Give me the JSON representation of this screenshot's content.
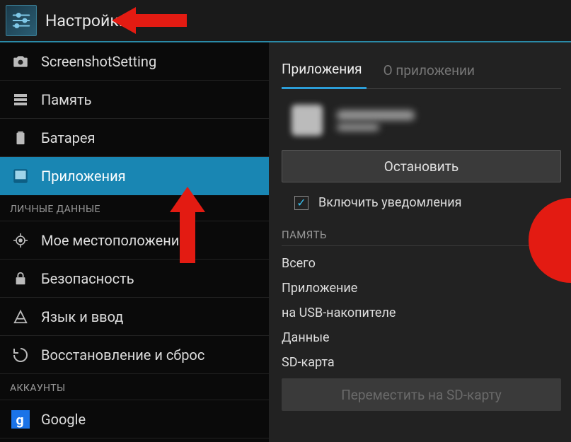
{
  "header": {
    "title": "Настройки"
  },
  "sidebar": {
    "items": [
      {
        "label": "ScreenshotSetting",
        "icon": "camera",
        "selected": false
      },
      {
        "label": "Память",
        "icon": "storage",
        "selected": false
      },
      {
        "label": "Батарея",
        "icon": "battery",
        "selected": false
      },
      {
        "label": "Приложения",
        "icon": "apps",
        "selected": true
      }
    ],
    "section_personal": "ЛИЧНЫЕ ДАННЫЕ",
    "items_personal": [
      {
        "label": "Мое местоположение",
        "icon": "location"
      },
      {
        "label": "Безопасность",
        "icon": "lock"
      },
      {
        "label": "Язык и ввод",
        "icon": "keyboard"
      },
      {
        "label": "Восстановление и сброс",
        "icon": "backup"
      }
    ],
    "section_accounts": "АККАУНТЫ",
    "items_accounts": [
      {
        "label": "Google",
        "icon": "google"
      }
    ]
  },
  "detail": {
    "tabs": {
      "apps": "Приложения",
      "about": "О приложении"
    },
    "btn_stop": "Остановить",
    "chk_notify": "Включить уведомления",
    "chk_notify_checked": true,
    "section_memory": "ПАМЯТЬ",
    "rows": {
      "total": "Всего",
      "app": "Приложение",
      "usb": "на USB-накопителе",
      "data": "Данные",
      "sd": "SD-карта"
    },
    "btn_move_sd": "Переместить на SD-карту"
  }
}
